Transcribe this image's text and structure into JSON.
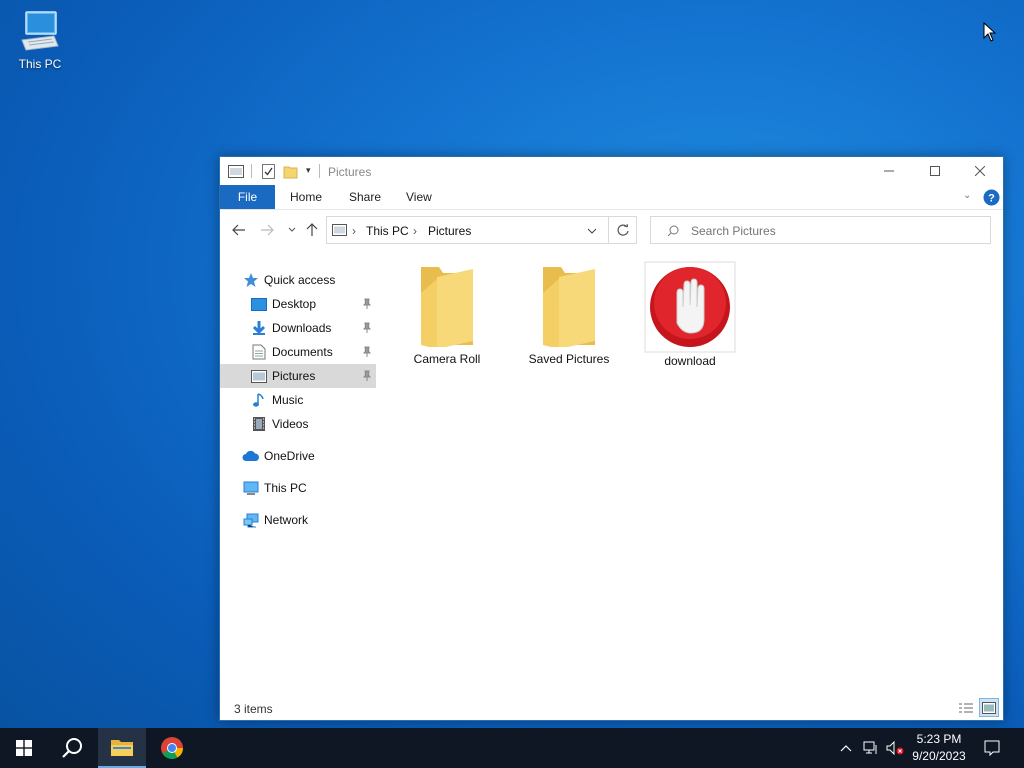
{
  "desktop": {
    "icon_label": "This PC"
  },
  "window": {
    "title": "Pictures",
    "ribbon_tabs": [
      "File",
      "Home",
      "Share",
      "View"
    ],
    "address": {
      "crumbs": [
        "This PC",
        "Pictures"
      ]
    },
    "search_placeholder": "Search Pictures",
    "sidebar": {
      "quick_access": "Quick access",
      "items": [
        "Desktop",
        "Downloads",
        "Documents",
        "Pictures",
        "Music",
        "Videos"
      ],
      "onedrive": "OneDrive",
      "this_pc": "This PC",
      "network": "Network"
    },
    "files": [
      "Camera Roll",
      "Saved Pictures",
      "download"
    ],
    "status": "3 items"
  },
  "taskbar": {
    "time": "5:23 PM",
    "date": "9/20/2023"
  },
  "colors": {
    "accent": "#1a6ac2",
    "selected": "#d9d9d9",
    "folder": "#f5d571",
    "taskbar": "#0e1723"
  }
}
